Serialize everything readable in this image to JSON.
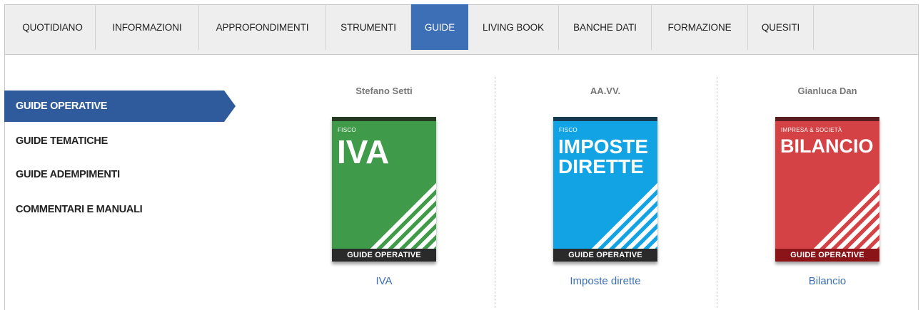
{
  "nav": {
    "items": [
      {
        "label": "QUOTIDIANO",
        "active": false
      },
      {
        "label": "INFORMAZIONI",
        "active": false
      },
      {
        "label": "APPROFONDIMENTI",
        "active": false
      },
      {
        "label": "STRUMENTI",
        "active": false
      },
      {
        "label": "GUIDE",
        "active": true
      },
      {
        "label": "LIVING BOOK",
        "active": false
      },
      {
        "label": "BANCHE DATI",
        "active": false
      },
      {
        "label": "FORMAZIONE",
        "active": false
      },
      {
        "label": "QUESITI",
        "active": false
      }
    ]
  },
  "sidebar": {
    "items": [
      {
        "label": "GUIDE OPERATIVE",
        "active": true
      },
      {
        "label": "GUIDE TEMATICHE",
        "active": false
      },
      {
        "label": "GUIDE ADEMPIMENTI",
        "active": false
      },
      {
        "label": "COMMENTARI E MANUALI",
        "active": false
      }
    ]
  },
  "books": [
    {
      "author": "Stefano Setti",
      "cover_kicker": "FISCO",
      "cover_lines": [
        "IVA"
      ],
      "series": "GUIDE OPERATIVE",
      "title": "IVA",
      "color": "#3f9b49"
    },
    {
      "author": "AA.VV.",
      "cover_kicker": "FISCO",
      "cover_lines": [
        "IMPOSTE",
        "DIRETTE"
      ],
      "series": "GUIDE OPERATIVE",
      "title": "Imposte dirette",
      "color": "#12a3e4"
    },
    {
      "author": "Gianluca Dan",
      "cover_kicker": "IMPRESA & SOCIETÀ",
      "cover_lines": [
        "BILANCIO"
      ],
      "series": "GUIDE OPERATIVE",
      "title": "Bilancio",
      "color": "#d54245"
    }
  ],
  "colors": {
    "accent": "#3c6fb6",
    "sidebar_active": "#2f5b9c",
    "nav_bg": "#eeeeee"
  }
}
